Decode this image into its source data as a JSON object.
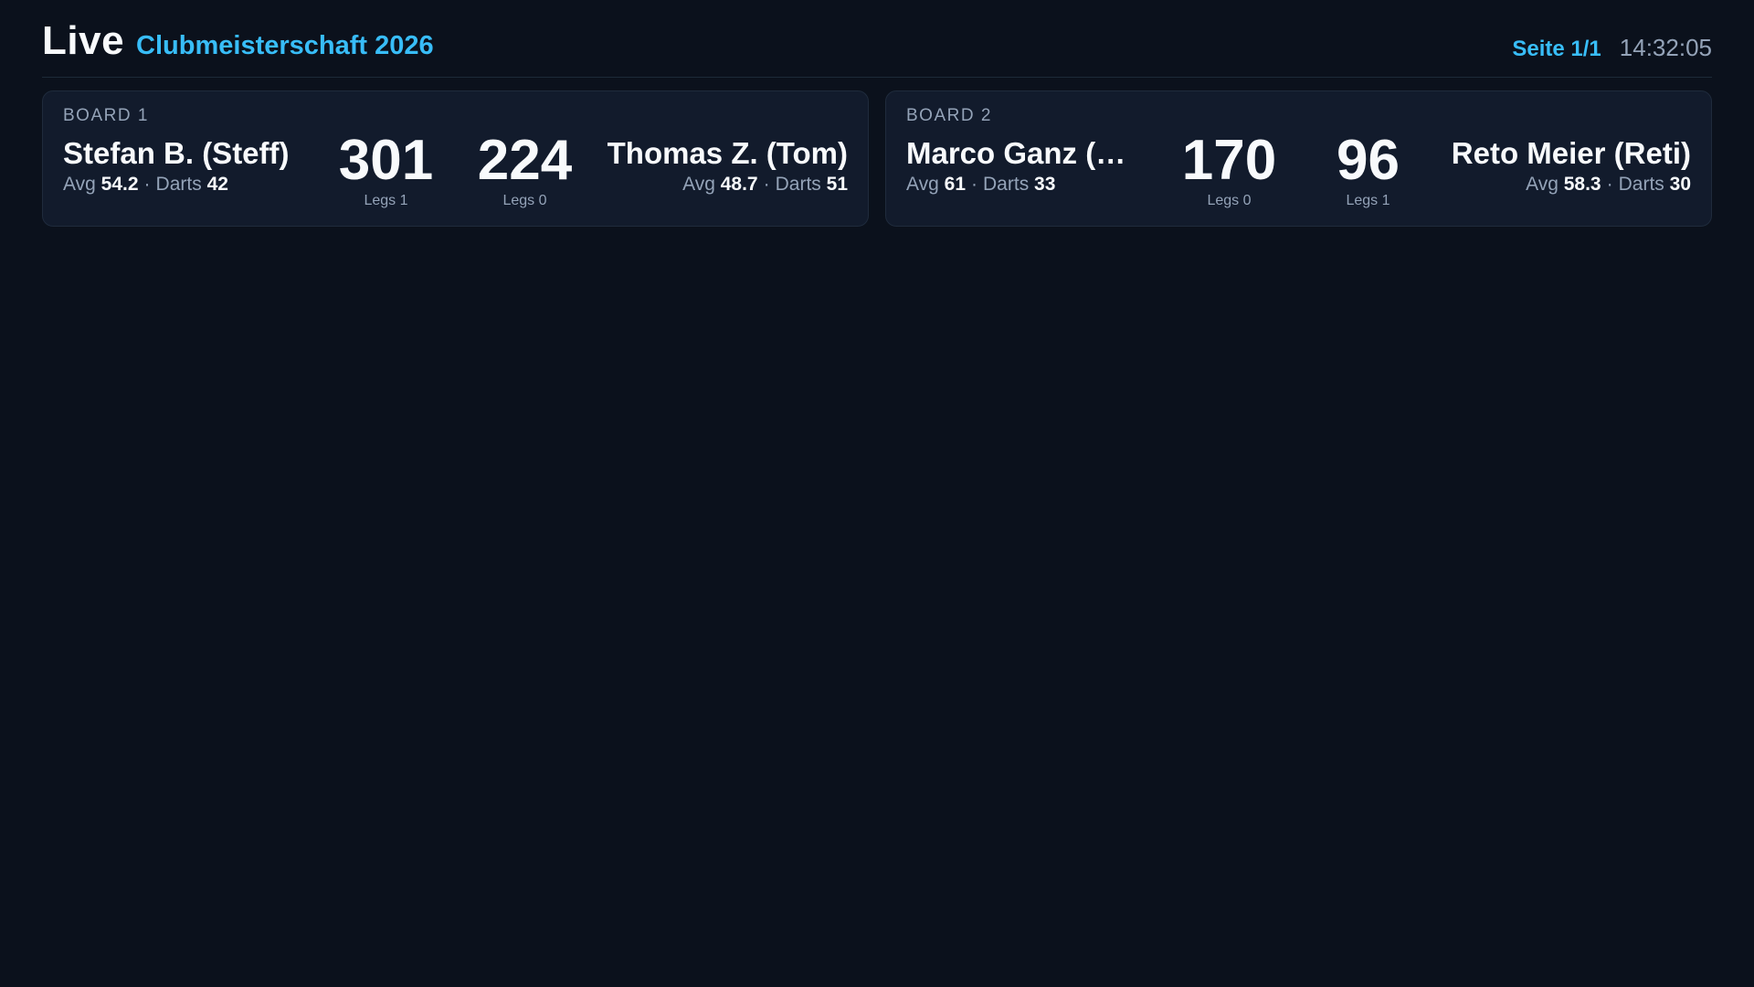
{
  "header": {
    "title": "Live",
    "event": "Clubmeisterschaft 2026",
    "page_indicator": "Seite 1/1",
    "clock": "14:32:05"
  },
  "colors": {
    "background": "#0b111c",
    "card": "#121b2c",
    "accent": "#38bdf8",
    "muted": "#94a3b8",
    "text": "#f8fafc"
  },
  "labels": {
    "avg": "Avg",
    "darts": "Darts",
    "legs": "Legs",
    "separator": "·"
  },
  "boards": [
    {
      "label": "BOARD 1",
      "player1": {
        "name": "Stefan B. (Steff)",
        "avg": "54.2",
        "darts": "42",
        "score": "301",
        "legs": "Legs 1"
      },
      "player2": {
        "name": "Thomas Z. (Tom)",
        "avg": "48.7",
        "darts": "51",
        "score": "224",
        "legs": "Legs 0"
      }
    },
    {
      "label": "BOARD 2",
      "player1": {
        "name": "Marco Ganz (…",
        "avg": "61",
        "darts": "33",
        "score": "170",
        "legs": "Legs 0"
      },
      "player2": {
        "name": "Reto Meier (Reti)",
        "avg": "58.3",
        "darts": "30",
        "score": "96",
        "legs": "Legs 1"
      }
    }
  ]
}
